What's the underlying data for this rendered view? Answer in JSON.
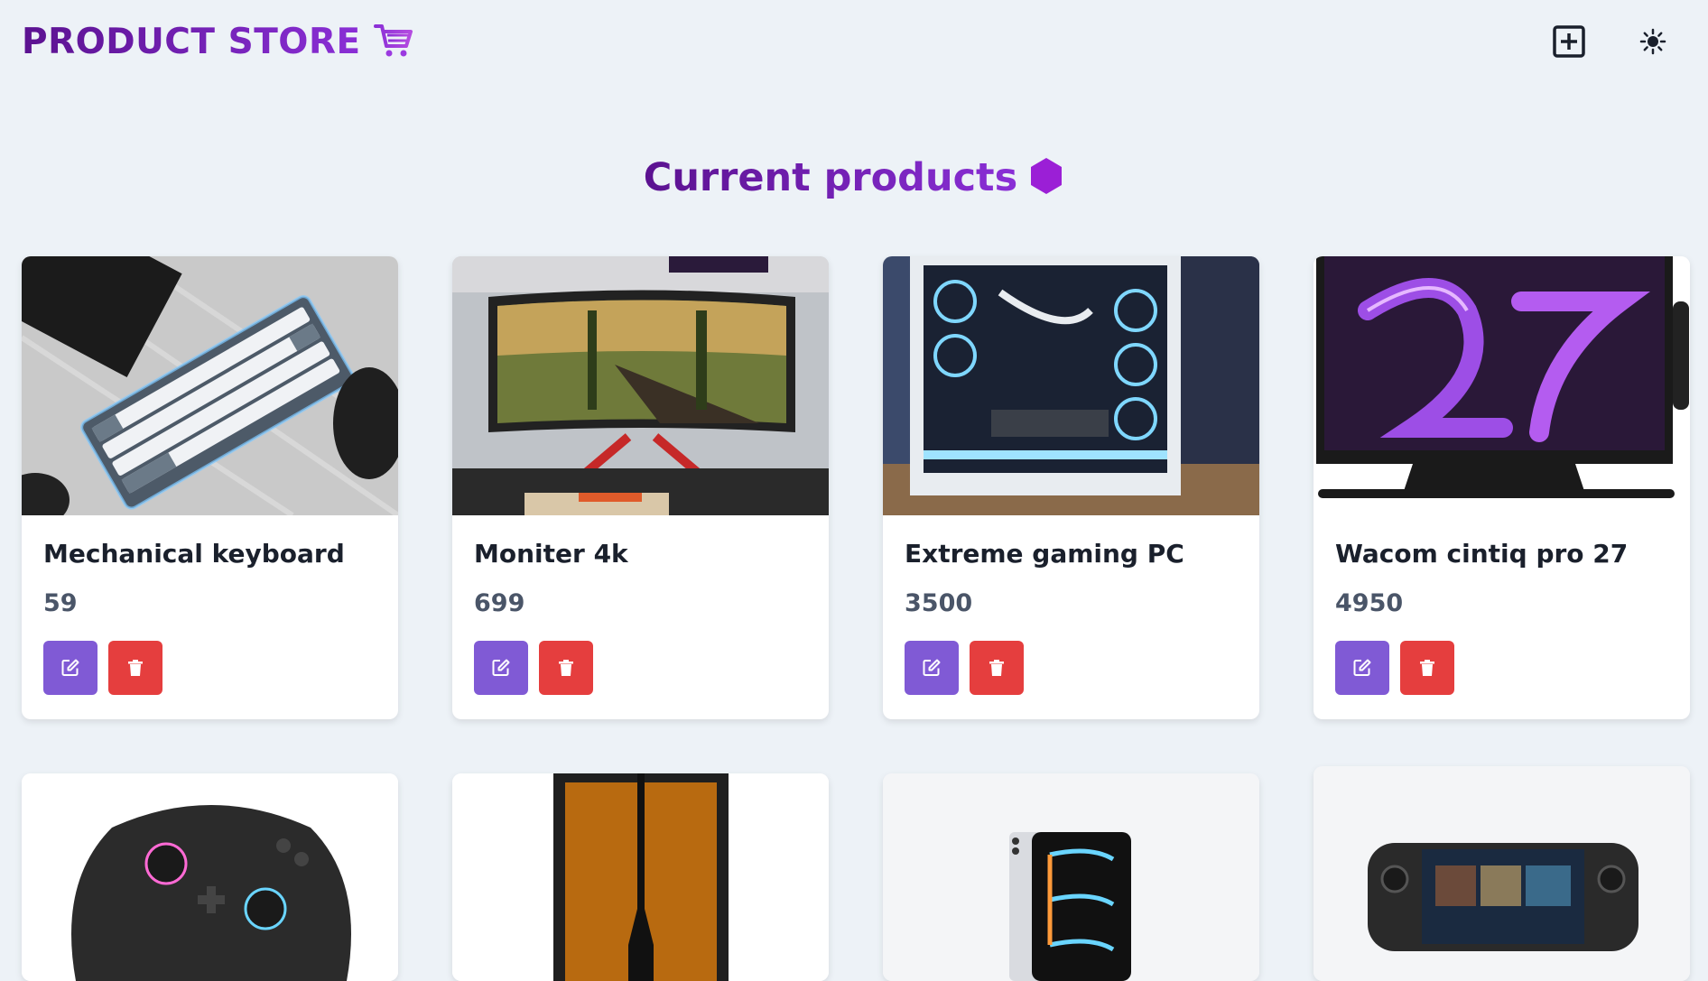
{
  "navbar": {
    "brand": "PRODUCT STORE",
    "brand_icon": "shopping-cart-icon",
    "add_icon": "plus-square-icon",
    "theme_icon": "sun-icon"
  },
  "page": {
    "heading": "Current products",
    "heading_icon": "hexagon-icon"
  },
  "colors": {
    "accent_purple": "#7b1fa2",
    "edit_button": "#805ad5",
    "delete_button": "#e53e3e",
    "background": "#edf2f7"
  },
  "products": [
    {
      "name": "Mechanical keyboard",
      "price": "59",
      "image": "keyboard"
    },
    {
      "name": "Moniter 4k",
      "price": "699",
      "image": "monitor"
    },
    {
      "name": "Extreme gaming PC",
      "price": "3500",
      "image": "gaming-pc"
    },
    {
      "name": "Wacom cintiq pro 27",
      "price": "4950",
      "image": "drawing-tablet"
    }
  ],
  "products_row2": [
    {
      "image": "game-controller"
    },
    {
      "image": "3d-printer"
    },
    {
      "image": "tablet"
    },
    {
      "image": "handheld-console"
    }
  ]
}
